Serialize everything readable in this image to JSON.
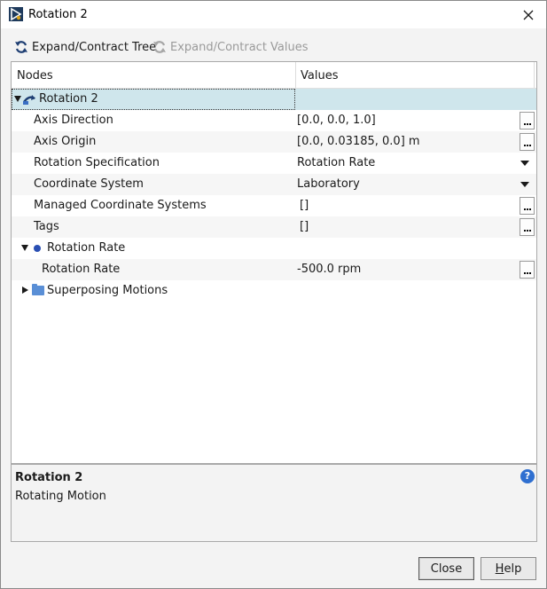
{
  "window": {
    "title": "Rotation 2"
  },
  "toolbar": {
    "expand_tree": "Expand/Contract Tree",
    "expand_values": "Expand/Contract Values"
  },
  "tree": {
    "headers": {
      "nodes": "Nodes",
      "values": "Values"
    },
    "root": {
      "label": "Rotation 2",
      "value": ""
    },
    "rows": [
      {
        "label": "Axis Direction",
        "value": "[0.0, 0.0, 1.0]"
      },
      {
        "label": "Axis Origin",
        "value": "[0.0, 0.03185, 0.0] m"
      },
      {
        "label": "Rotation Specification",
        "value": "Rotation Rate"
      },
      {
        "label": "Coordinate System",
        "value": "Laboratory"
      },
      {
        "label": "Managed Coordinate Systems",
        "value": "[]"
      },
      {
        "label": "Tags",
        "value": "[]"
      },
      {
        "label": "Rotation Rate",
        "value": ""
      },
      {
        "label": "Rotation Rate",
        "value": "-500.0 rpm"
      },
      {
        "label": "Superposing Motions",
        "value": ""
      }
    ]
  },
  "description": {
    "title": "Rotation 2",
    "text": "Rotating Motion"
  },
  "buttons": {
    "close": "Close",
    "help_first": "H",
    "help_rest": "elp"
  },
  "colors": {
    "selection": "#cfe6ec",
    "accent": "#2a4fb3",
    "help": "#2f6fd0"
  },
  "icons": {
    "app": "star-ccm-icon",
    "close": "close-icon",
    "refresh": "refresh-icon",
    "help": "help-icon",
    "rotation": "rotation-motion-icon",
    "folder": "folder-icon"
  }
}
